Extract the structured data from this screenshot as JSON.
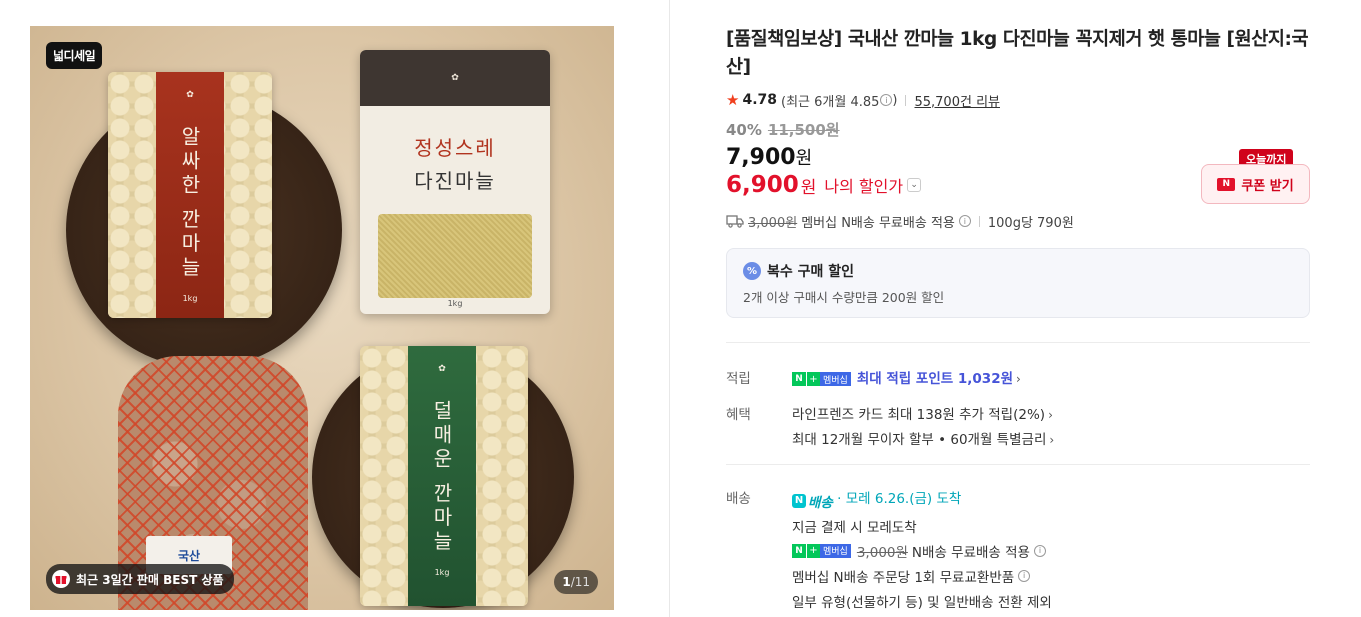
{
  "gallery": {
    "brand_badge": "넓디세일",
    "best_badge": "최근 3일간 판매 BEST 상품",
    "pager_current": "1",
    "pager_total": "/11",
    "bag_red_text": "알싸한 깐마늘",
    "bag_red_weight": "1kg",
    "bag_white_line1": "정성스레",
    "bag_white_line2": "다진마늘",
    "bag_white_weight": "1kg",
    "bag_green_text": "덜매운 깐마늘",
    "bag_green_weight": "1kg",
    "net_label": "국산"
  },
  "product": {
    "title": "[품질책임보상] 국내산 깐마늘 1kg 다진마늘 꼭지제거 햇 통마늘 [원산지:국산]",
    "rating": "4.78",
    "rating_recent": "(최근 6개월 4.85",
    "rating_recent_close": ")",
    "reviews": "55,700건 리뷰",
    "discount_pct": "40%",
    "original_price": "11,500원",
    "price": "7,900",
    "price_unit": "원",
    "my_price": "6,900",
    "my_price_unit": "원",
    "my_price_label": "나의 할인가",
    "coupon_tag": "오늘까지",
    "coupon_label": "쿠폰 받기",
    "shipping_fee": "3,000원",
    "shipping_note": "멤버십 N배송 무료배송 적용",
    "unit_price": "100g당 790원"
  },
  "multi_buy": {
    "title": "복수 구매 할인",
    "desc": "2개 이상 구매시 수량만큼 200원 할인"
  },
  "benefits": {
    "points_label": "적립",
    "membership_badge": "멤버십",
    "points_text": "최대 적립 포인트 1,032원",
    "benefit_label": "혜택",
    "card_text": "라인프렌즈 카드 최대 138원 추가 적립(2%)",
    "installment_text": "최대 12개월 무이자 할부 • 60개월 특별금리"
  },
  "delivery": {
    "label": "배송",
    "nship_label": "배송",
    "arrival": "· 모레 6.26.(금) 도착",
    "pay_now": "지금 결제 시 모레도착",
    "membership_badge": "멤버십",
    "fee_strike": "3,000원",
    "fee_note": "N배송 무료배송 적용",
    "exchange": "멤버십 N배송 주문당 1회 무료교환반품",
    "exclude": "일부 유형(선물하기 등) 및 일반배송 전환 제외"
  },
  "colors": {
    "accent_red": "#e2112b",
    "naver_green": "#03c75a",
    "point_blue": "#4654d8",
    "nship_teal": "#00a6b8"
  }
}
